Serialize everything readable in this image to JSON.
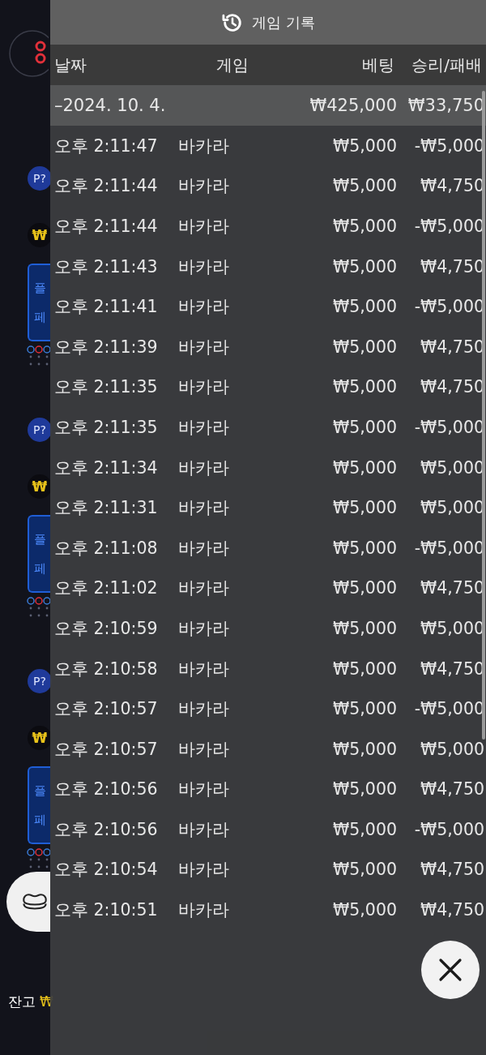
{
  "side_tables": [
    {
      "badge": "P?",
      "coin": "₩",
      "button_lines": [
        "플",
        "페"
      ]
    },
    {
      "badge": "P?",
      "coin": "₩",
      "button_lines": [
        "플",
        "페"
      ]
    },
    {
      "badge": "P?",
      "coin": "₩",
      "button_lines": [
        "플",
        "페"
      ]
    }
  ],
  "balance": {
    "label": "잔고",
    "amount": "₩"
  },
  "history": {
    "title": "게임 기록",
    "columns": [
      "날짜",
      "게임",
      "베팅",
      "승리/패배"
    ],
    "summary": {
      "date": "–2024. 10. 4.",
      "bet": "₩425,000",
      "result": "₩33,750"
    },
    "rows": [
      {
        "time": "오후 2:11:47",
        "game": "바카라",
        "bet": "₩5,000",
        "result": "-₩5,000"
      },
      {
        "time": "오후 2:11:44",
        "game": "바카라",
        "bet": "₩5,000",
        "result": "₩4,750"
      },
      {
        "time": "오후 2:11:44",
        "game": "바카라",
        "bet": "₩5,000",
        "result": "-₩5,000"
      },
      {
        "time": "오후 2:11:43",
        "game": "바카라",
        "bet": "₩5,000",
        "result": "₩4,750"
      },
      {
        "time": "오후 2:11:41",
        "game": "바카라",
        "bet": "₩5,000",
        "result": "-₩5,000"
      },
      {
        "time": "오후 2:11:39",
        "game": "바카라",
        "bet": "₩5,000",
        "result": "₩4,750"
      },
      {
        "time": "오후 2:11:35",
        "game": "바카라",
        "bet": "₩5,000",
        "result": "₩4,750"
      },
      {
        "time": "오후 2:11:35",
        "game": "바카라",
        "bet": "₩5,000",
        "result": "-₩5,000"
      },
      {
        "time": "오후 2:11:34",
        "game": "바카라",
        "bet": "₩5,000",
        "result": "₩5,000"
      },
      {
        "time": "오후 2:11:31",
        "game": "바카라",
        "bet": "₩5,000",
        "result": "₩5,000"
      },
      {
        "time": "오후 2:11:08",
        "game": "바카라",
        "bet": "₩5,000",
        "result": "-₩5,000"
      },
      {
        "time": "오후 2:11:02",
        "game": "바카라",
        "bet": "₩5,000",
        "result": "₩4,750"
      },
      {
        "time": "오후 2:10:59",
        "game": "바카라",
        "bet": "₩5,000",
        "result": "₩5,000"
      },
      {
        "time": "오후 2:10:58",
        "game": "바카라",
        "bet": "₩5,000",
        "result": "₩4,750"
      },
      {
        "time": "오후 2:10:57",
        "game": "바카라",
        "bet": "₩5,000",
        "result": "-₩5,000"
      },
      {
        "time": "오후 2:10:57",
        "game": "바카라",
        "bet": "₩5,000",
        "result": "₩5,000"
      },
      {
        "time": "오후 2:10:56",
        "game": "바카라",
        "bet": "₩5,000",
        "result": "₩4,750"
      },
      {
        "time": "오후 2:10:56",
        "game": "바카라",
        "bet": "₩5,000",
        "result": "-₩5,000"
      },
      {
        "time": "오후 2:10:54",
        "game": "바카라",
        "bet": "₩5,000",
        "result": "₩4,750"
      },
      {
        "time": "오후 2:10:51",
        "game": "바카라",
        "bet": "₩5,000",
        "result": "₩4,750"
      }
    ]
  }
}
